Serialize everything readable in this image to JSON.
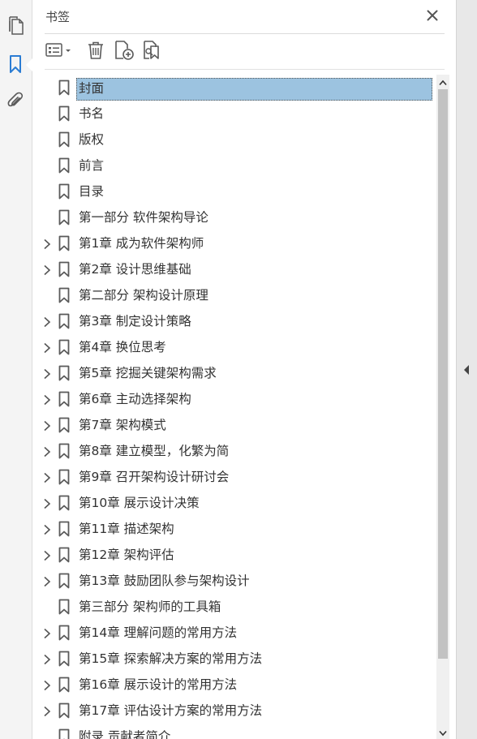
{
  "panel": {
    "title": "书签"
  },
  "toolbar": {
    "options_icon": "list-options-icon",
    "delete_icon": "trash-icon",
    "new_bookmark_icon": "new-bookmark-icon",
    "bookmark_search_icon": "bookmark-search-icon"
  },
  "bookmarks": [
    {
      "label": "封面",
      "expandable": false,
      "selected": true
    },
    {
      "label": "书名",
      "expandable": false,
      "selected": false
    },
    {
      "label": "版权",
      "expandable": false,
      "selected": false
    },
    {
      "label": "前言",
      "expandable": false,
      "selected": false
    },
    {
      "label": "目录",
      "expandable": false,
      "selected": false
    },
    {
      "label": "第一部分  软件架构导论",
      "expandable": false,
      "selected": false
    },
    {
      "label": "第1章  成为软件架构师",
      "expandable": true,
      "selected": false
    },
    {
      "label": "第2章  设计思维基础",
      "expandable": true,
      "selected": false
    },
    {
      "label": "第二部分  架构设计原理",
      "expandable": false,
      "selected": false
    },
    {
      "label": "第3章  制定设计策略",
      "expandable": true,
      "selected": false
    },
    {
      "label": "第4章  换位思考",
      "expandable": true,
      "selected": false
    },
    {
      "label": "第5章  挖掘关键架构需求",
      "expandable": true,
      "selected": false
    },
    {
      "label": "第6章  主动选择架构",
      "expandable": true,
      "selected": false
    },
    {
      "label": "第7章  架构模式",
      "expandable": true,
      "selected": false
    },
    {
      "label": "第8章  建立模型，化繁为简",
      "expandable": true,
      "selected": false
    },
    {
      "label": "第9章  召开架构设计研讨会",
      "expandable": true,
      "selected": false
    },
    {
      "label": "第10章  展示设计决策",
      "expandable": true,
      "selected": false
    },
    {
      "label": "第11章  描述架构",
      "expandable": true,
      "selected": false
    },
    {
      "label": "第12章  架构评估",
      "expandable": true,
      "selected": false
    },
    {
      "label": "第13章  鼓励团队参与架构设计",
      "expandable": true,
      "selected": false
    },
    {
      "label": "第三部分  架构师的工具箱",
      "expandable": false,
      "selected": false
    },
    {
      "label": "第14章  理解问题的常用方法",
      "expandable": true,
      "selected": false
    },
    {
      "label": "第15章  探索解决方案的常用方法",
      "expandable": true,
      "selected": false
    },
    {
      "label": "第16章  展示设计的常用方法",
      "expandable": true,
      "selected": false
    },
    {
      "label": "第17章  评估设计方案的常用方法",
      "expandable": true,
      "selected": false
    },
    {
      "label": "附录  贡献者简介",
      "expandable": false,
      "selected": false
    }
  ],
  "colors": {
    "accent": "#2b7cd3",
    "selection": "#9cc3e0",
    "icon": "#5a5a5a"
  }
}
